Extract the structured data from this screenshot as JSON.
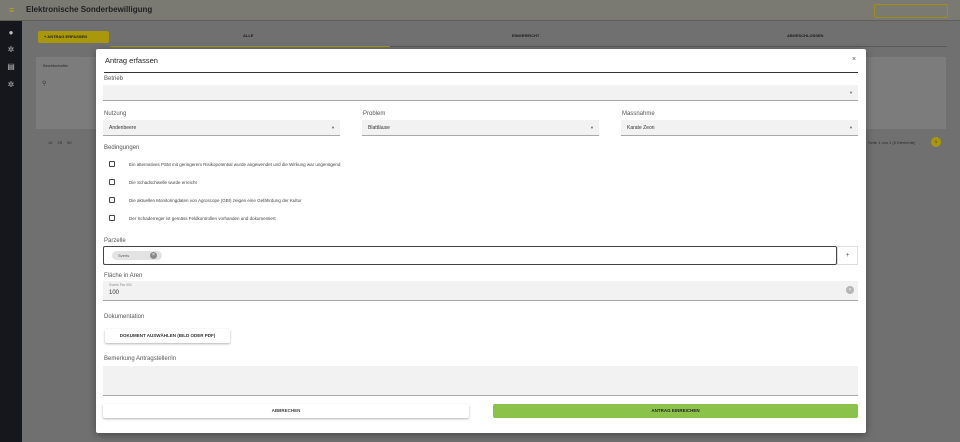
{
  "app": {
    "title": "Elektronische Sonderbewilligung",
    "menu_icon": "menu-icon"
  },
  "sidebar": {
    "items": [
      {
        "icon": "user-icon",
        "glyph": "●"
      },
      {
        "icon": "gear-icon",
        "glyph": "✲"
      },
      {
        "icon": "document-icon",
        "glyph": "▤"
      },
      {
        "icon": "settings-icon",
        "glyph": "✲"
      }
    ]
  },
  "background": {
    "add_button_label": "+  ANTRAG ERFASSEN",
    "tabs": [
      "ALLE",
      "EINGEREICHT",
      "ABGESCHLOSSEN"
    ],
    "table_column": "Bewirtschafter",
    "search_glyph": "⚲",
    "page_sizes": "10  25  50",
    "pager_info": "Seite 1 von 1 (0 Elemente)",
    "current_page": "1"
  },
  "dialog": {
    "title": "Antrag erfassen",
    "close_glyph": "×",
    "betrieb": {
      "label": "Betrieb",
      "value": ""
    },
    "nutzung": {
      "label": "Nutzung",
      "value": "Andenbeere"
    },
    "problem": {
      "label": "Problem",
      "value": "Blattläuse"
    },
    "massnahme": {
      "label": "Massnahme",
      "value": "Karate Zeon"
    },
    "bedingungen": {
      "label": "Bedingungen",
      "items": [
        {
          "text": "Ein alternatives PSM mit geringerem Risikopotential wurde angewendet und die Wirkung war ungenügend",
          "checked": false
        },
        {
          "text": "Die Schadschwelle wurde erreicht",
          "checked": false
        },
        {
          "text": "Die aktuellen Monitoringdaten von Agroscope (GBI) zeigen eine Gefährdung der Kultur",
          "checked": false
        },
        {
          "text": "Der Schaderreger ist gemäss Feldkontrollen vorhanden und dokumentiert",
          "checked": false
        }
      ]
    },
    "parzelle": {
      "label": "Parzelle",
      "chips": [
        "Sveris"
      ],
      "add_glyph": "+"
    },
    "flaeche": {
      "label": "Fläche in Aren",
      "hint": "Sveris Par 001",
      "value": "100"
    },
    "dokumentation": {
      "label": "Dokumentation",
      "button_label": "DOKUMENT AUSWÄHLEN (BILD ODER PDF)"
    },
    "bemerkung": {
      "label": "Bemerkung Antragsteller/in",
      "value": ""
    },
    "cancel_label": "ABBRECHEN",
    "submit_label": "ANTRAG EINREICHEN"
  },
  "colors": {
    "accent_yellow": "#f2d21b",
    "submit_green": "#8bc34a",
    "sidebar_dark": "#16161d"
  }
}
